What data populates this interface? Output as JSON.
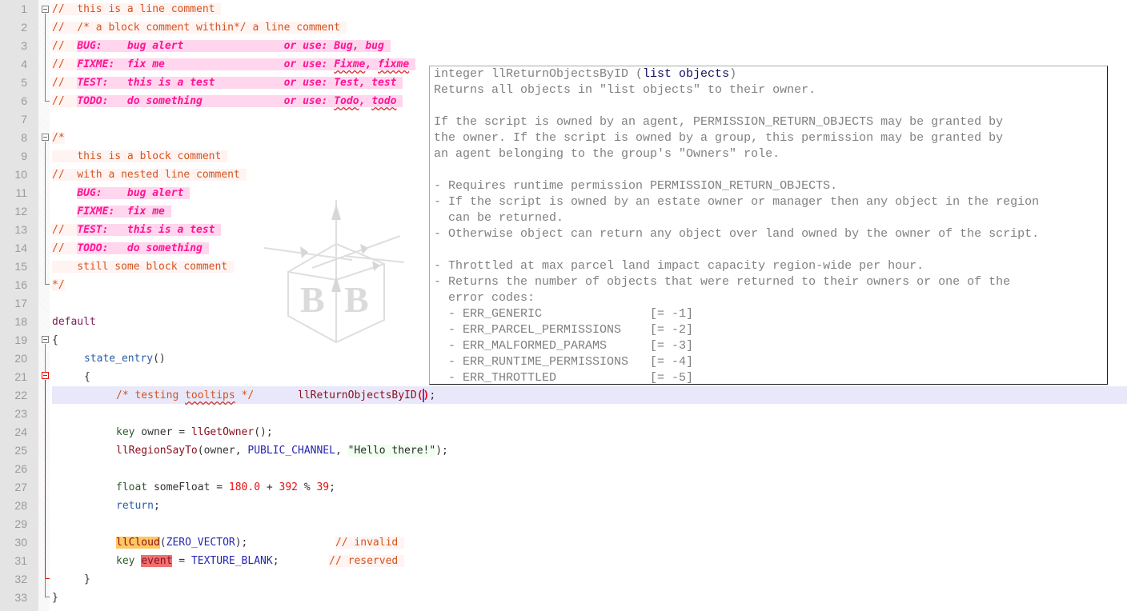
{
  "editor": {
    "line_numbers": [
      "1",
      "2",
      "3",
      "4",
      "5",
      "6",
      "7",
      "8",
      "9",
      "10",
      "11",
      "12",
      "13",
      "14",
      "15",
      "16",
      "17",
      "18",
      "19",
      "20",
      "21",
      "22",
      "23",
      "24",
      "25",
      "26",
      "27",
      "28",
      "29",
      "30",
      "31",
      "32",
      "33"
    ],
    "lines": {
      "l1": {
        "comment": "//  this is a line comment "
      },
      "l2": {
        "comment": "//  /* a block comment within*/ a line comment "
      },
      "l3": {
        "prefix": "//  ",
        "tag": "BUG:    bug alert                or use: Bug, bug "
      },
      "l4": {
        "prefix": "//  ",
        "tag_a": "FIXME:  fix me                   or use: ",
        "tag_w1": "Fixme",
        "tag_sep": ", ",
        "tag_w2": "fixme",
        "tag_end": " "
      },
      "l5": {
        "prefix": "//  ",
        "tag": "TEST:   this is a test           or use: Test, test "
      },
      "l6": {
        "prefix": "//  ",
        "tag_a": "TODO:   do something             or use: ",
        "tag_w1": "Todo",
        "tag_sep": ", ",
        "tag_w2": "todo",
        "tag_end": " "
      },
      "l8": {
        "comment": "/*"
      },
      "l9": {
        "comment": "    this is a block comment "
      },
      "l10": {
        "comment": "//  with a nested line comment "
      },
      "l11": {
        "prefix": "    ",
        "tag": "BUG:    bug alert "
      },
      "l12": {
        "prefix": "    ",
        "tag": "FIXME:  fix me "
      },
      "l13": {
        "prefix": "//  ",
        "tag": "TEST:   this is a test "
      },
      "l14": {
        "prefix": "//  ",
        "tag": "TODO:   do something "
      },
      "l15": {
        "comment": "    still some block comment "
      },
      "l16": {
        "comment": "*/"
      },
      "l18": {
        "keyword": "default"
      },
      "l19": {
        "brace": "{"
      },
      "l20": {
        "event": "state_entry",
        "parens": "()"
      },
      "l21": {
        "brace": "{"
      },
      "l22": {
        "comment_a": "/* testing ",
        "comment_w": "tooltips",
        "comment_b": " */",
        "gap": "       ",
        "func": "llReturnObjectsByID",
        "open": "(",
        "close": ")",
        "end": ";"
      },
      "l24": {
        "type": "key",
        "rest": " owner = ",
        "func": "llGetOwner",
        "end": "();"
      },
      "l25": {
        "func": "llRegionSayTo",
        "a": "(owner, ",
        "const": "PUBLIC_CHANNEL",
        "b": ", ",
        "str": "\"Hello there!\"",
        "end": ");"
      },
      "l27": {
        "type": "float",
        "rest": " someFloat = ",
        "n1": "180.0",
        "op1": " + ",
        "n2": "392",
        "op2": " % ",
        "n3": "39",
        "end": ";"
      },
      "l28": {
        "keyword": "return",
        "end": ";"
      },
      "l30": {
        "func": "llCloud",
        "a": "(",
        "const": "ZERO_VECTOR",
        "end": ");",
        "gap": "              ",
        "comment": "// invalid "
      },
      "l31": {
        "type": "key",
        "sp": " ",
        "reserved": "event",
        "rest": " = ",
        "const": "TEXTURE_BLANK",
        "end": ";",
        "gap": "        ",
        "comment": "// reserved "
      },
      "l32": {
        "brace": "}"
      },
      "l33": {
        "brace": "}"
      }
    }
  },
  "tooltip": {
    "signature_return": "integer llReturnObjectsByID (",
    "signature_param": "list objects",
    "signature_close": ")",
    "lines": [
      "Returns all objects in \"list objects\" to their owner.",
      "",
      "If the script is owned by an agent, PERMISSION_RETURN_OBJECTS may be granted by",
      "the owner. If the script is owned by a group, this permission may be granted by",
      "an agent belonging to the group's \"Owners\" role.",
      "",
      "- Requires runtime permission PERMISSION_RETURN_OBJECTS.",
      "- If the script is owned by an estate owner or manager then any object in the region",
      "  can be returned.",
      "- Otherwise object can return any object over land owned by the owner of the script.",
      "",
      "- Throttled at max parcel land impact capacity region-wide per hour.",
      "- Returns the number of objects that were returned to their owners or one of the",
      "  error codes:",
      "  - ERR_GENERIC               [= -1]",
      "  - ERR_PARCEL_PERMISSIONS    [= -2]",
      "  - ERR_MALFORMED_PARAMS      [= -3]",
      "  - ERR_RUNTIME_PERMISSIONS   [= -4]",
      "  - ERR_THROTTLED             [= -5]"
    ]
  },
  "watermark": {
    "letters": "B B"
  }
}
